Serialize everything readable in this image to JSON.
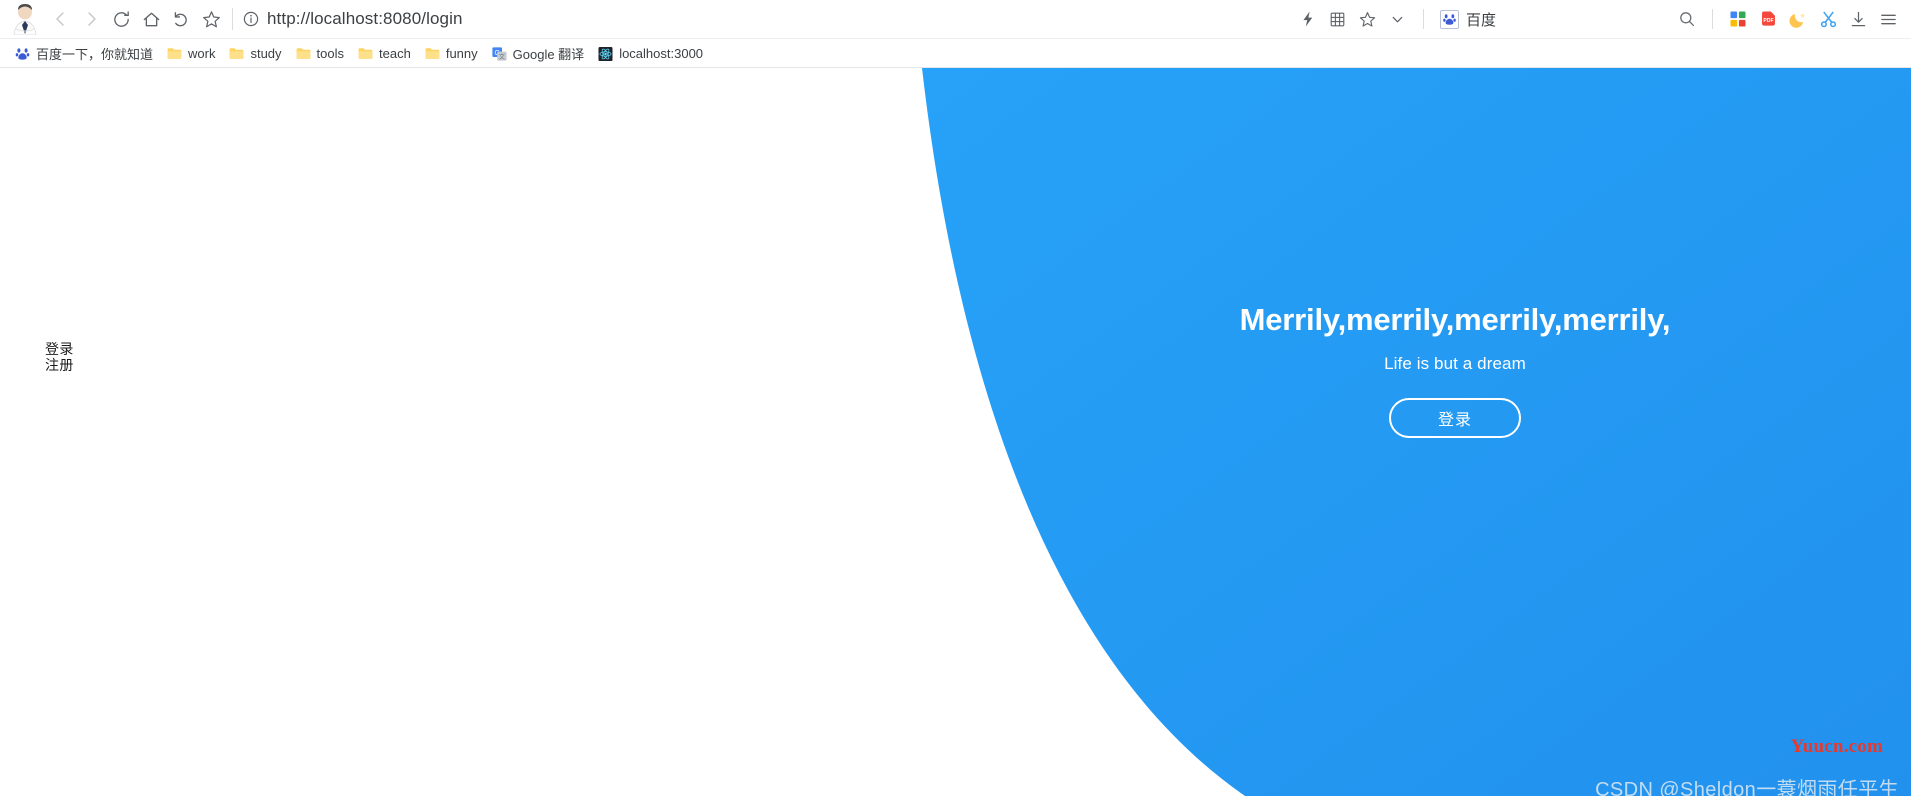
{
  "browser": {
    "avatar_name": "user-avatar",
    "nav": {
      "back": "back-arrow",
      "forward": "forward-arrow",
      "reload": "reload",
      "home": "home",
      "history_back": "undo-arrow",
      "bookmark_star": "star"
    },
    "url": {
      "value": "http://localhost:8080/login",
      "security_icon": "info-circle"
    },
    "right_icons": [
      "lightning-icon",
      "grid-icon",
      "star-icon",
      "chevron-down-icon"
    ],
    "search_engine_chip": {
      "label": "百度",
      "icon": "baidu-paw-icon"
    },
    "far_right_icons": [
      "search-icon",
      "apps-grid-icon",
      "pdf-icon",
      "moon-icon",
      "scissors-icon",
      "download-icon",
      "menu-icon"
    ],
    "bookmarks": [
      {
        "label": "百度一下，你就知道",
        "icon": "baidu-paw-icon"
      },
      {
        "label": "work",
        "icon": "folder-icon"
      },
      {
        "label": "study",
        "icon": "folder-icon"
      },
      {
        "label": "tools",
        "icon": "folder-icon"
      },
      {
        "label": "teach",
        "icon": "folder-icon"
      },
      {
        "label": "funny",
        "icon": "folder-icon"
      },
      {
        "label": "Google 翻译",
        "icon": "google-translate-icon"
      },
      {
        "label": "localhost:3000",
        "icon": "react-icon"
      }
    ]
  },
  "page": {
    "left_links": [
      {
        "label": "登录"
      },
      {
        "label": "注册"
      }
    ],
    "hero": {
      "title": "Merrily,merrily,merrily,merrily,",
      "subtitle": "Life is but a dream",
      "button_label": "登录"
    },
    "watermarks": {
      "yuucn": "Yuucn.com",
      "csdn": "CSDN @Sheldon一蓑烟雨任平生"
    },
    "colors": {
      "accent_blue": "#2196f3",
      "blue_light": "#29a3f7",
      "watermark_red": "#e8392c"
    }
  }
}
